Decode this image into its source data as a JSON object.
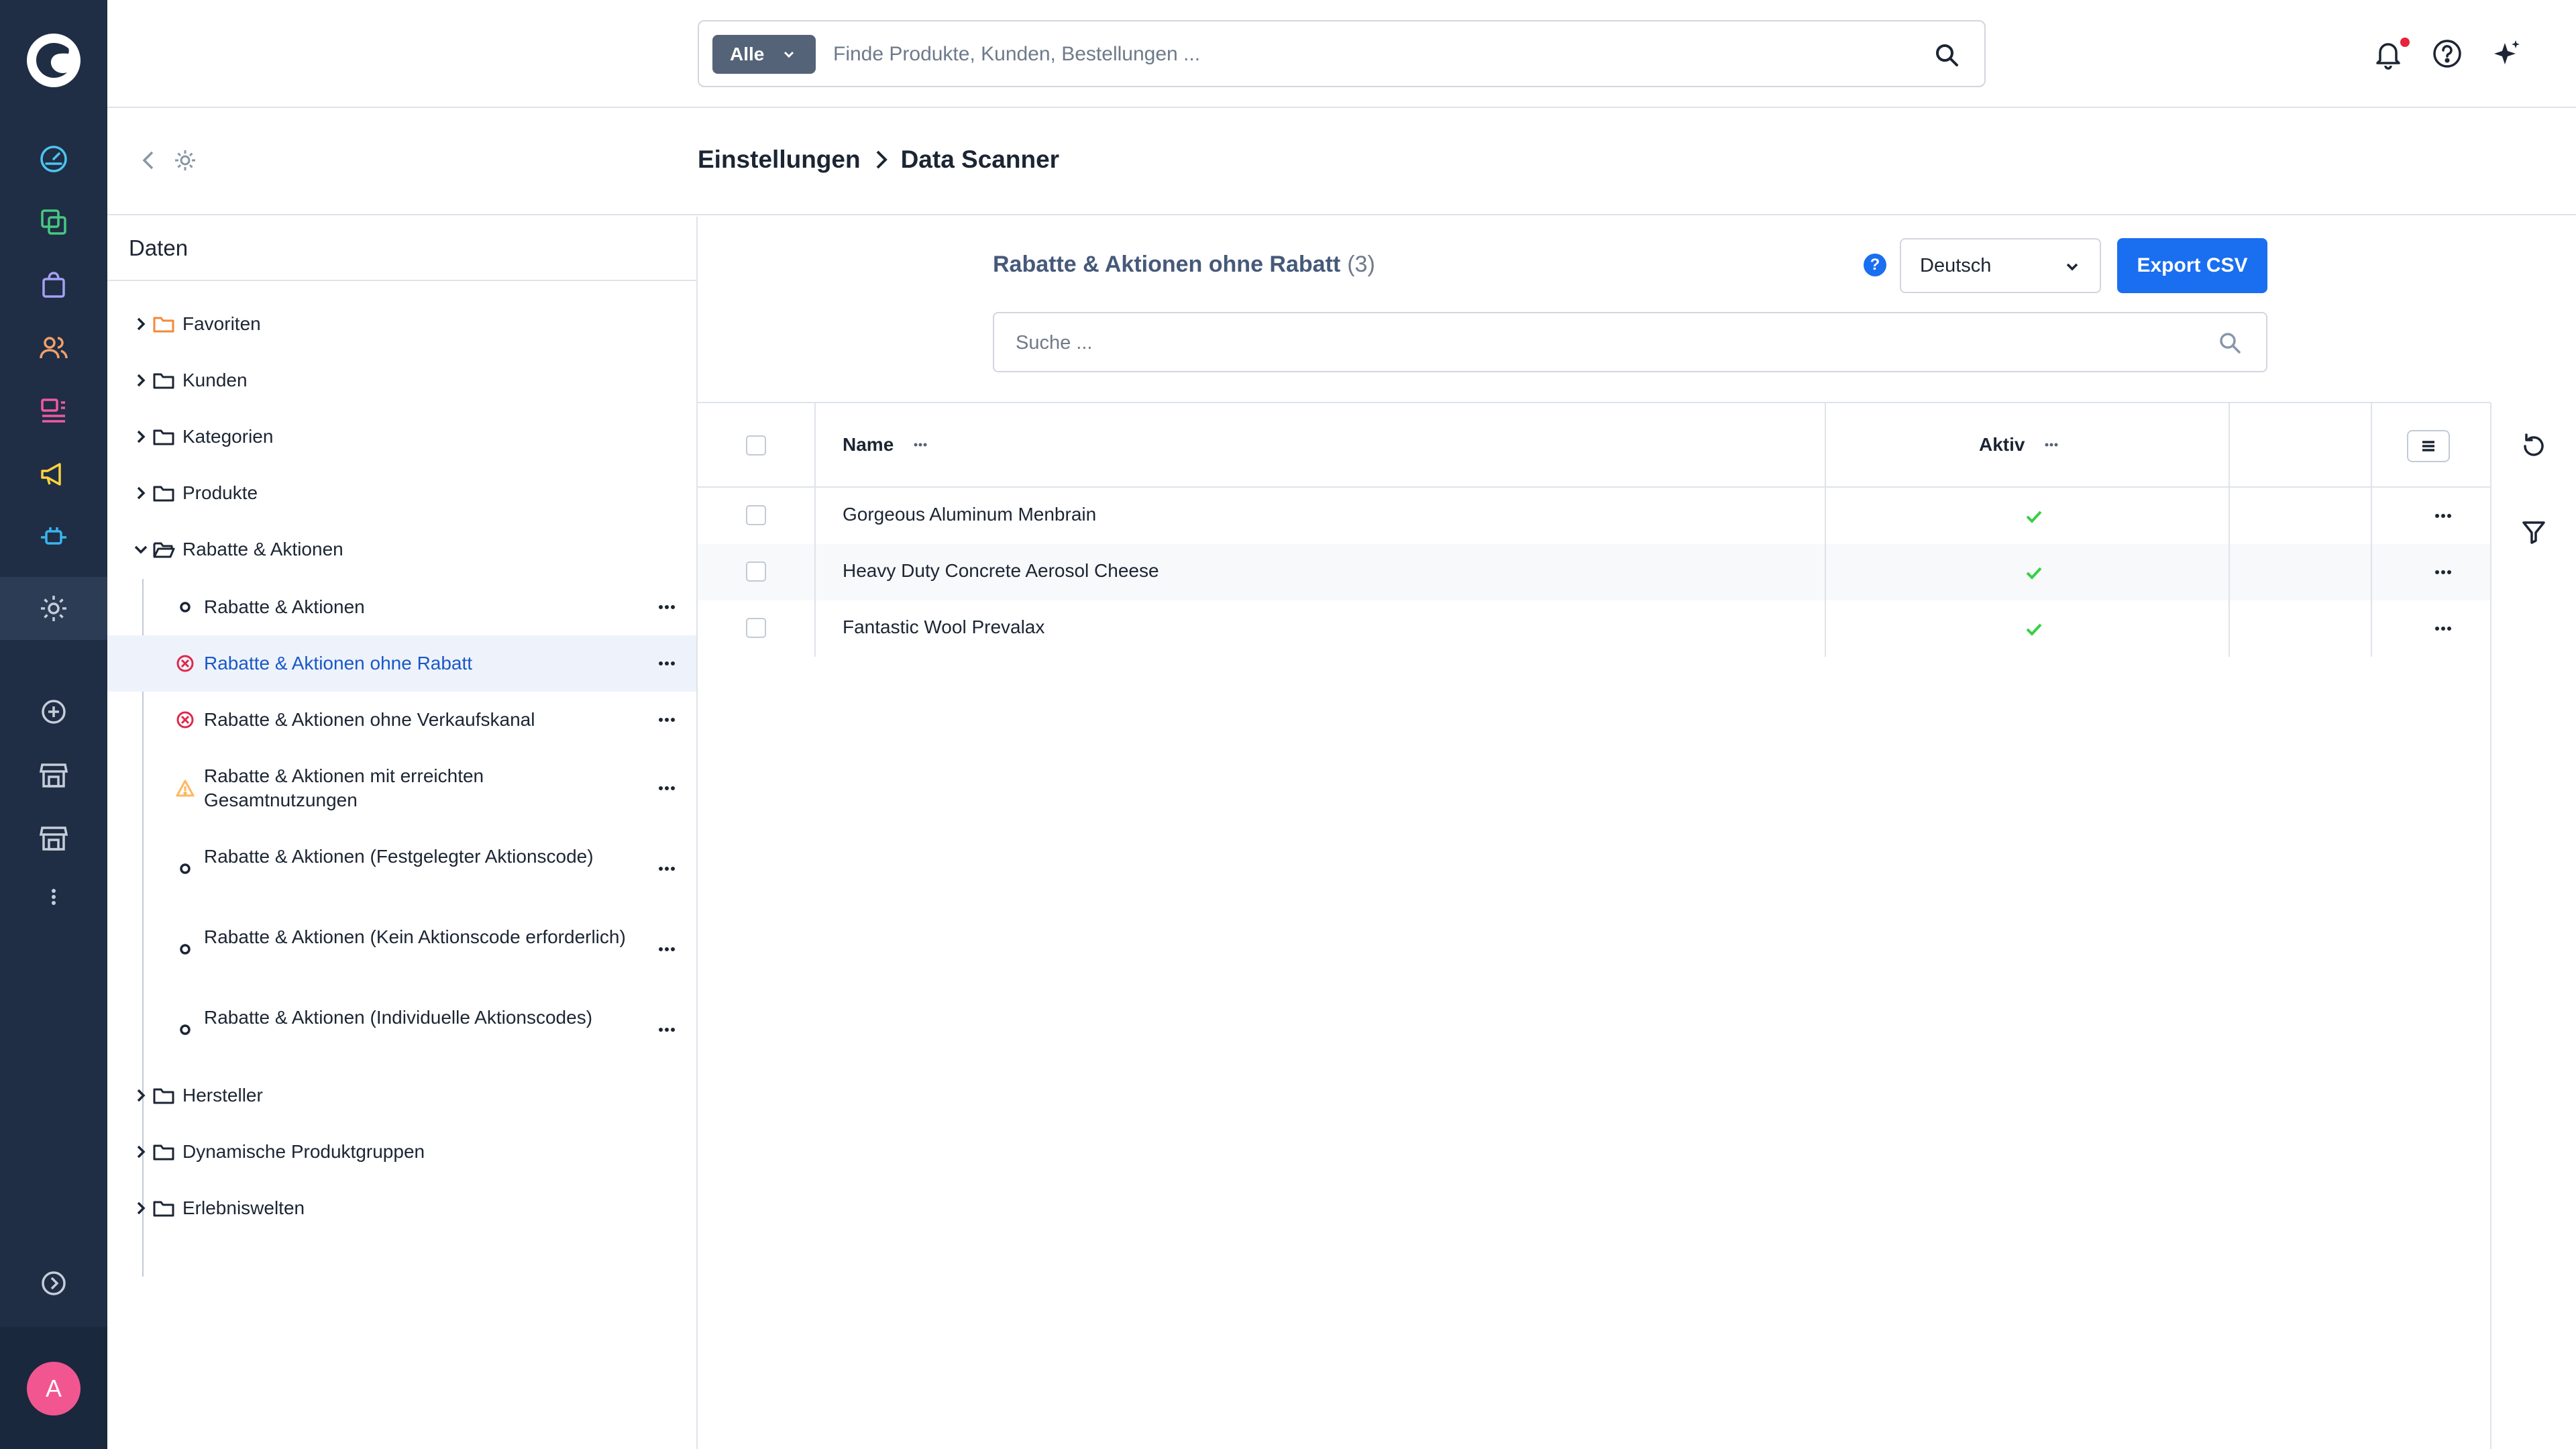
{
  "header": {
    "search_type": "Alle",
    "search_placeholder": "Finde Produkte, Kunden, Bestellungen ..."
  },
  "breadcrumb": {
    "parent": "Einstellungen",
    "current": "Data Scanner"
  },
  "user": {
    "avatar_initial": "A"
  },
  "tree": {
    "title": "Daten",
    "folders_top": [
      {
        "label": "Favoriten",
        "icon": "folder-icon",
        "color": "#f28a3a"
      },
      {
        "label": "Kunden",
        "icon": "folder-icon"
      },
      {
        "label": "Kategorien",
        "icon": "folder-icon"
      },
      {
        "label": "Produkte",
        "icon": "folder-icon"
      },
      {
        "label": "Rabatte & Aktionen",
        "icon": "folder-open-icon",
        "expanded": true
      }
    ],
    "children": [
      {
        "label": "Rabatte & Aktionen",
        "status": "neutral"
      },
      {
        "label": "Rabatte & Aktionen ohne Rabatt",
        "status": "error",
        "selected": true
      },
      {
        "label": "Rabatte & Aktionen ohne Verkaufskanal",
        "status": "error"
      },
      {
        "label": "Rabatte & Aktionen mit erreichten Gesamtnutzungen",
        "status": "warning"
      },
      {
        "label": "Rabatte & Aktionen (Festgelegter Aktionscode)",
        "status": "neutral"
      },
      {
        "label": "Rabatte & Aktionen (Kein Aktionscode erforderlich)",
        "status": "neutral"
      },
      {
        "label": "Rabatte & Aktionen (Individuelle Aktionscodes)",
        "status": "neutral"
      }
    ],
    "folders_bottom": [
      {
        "label": "Hersteller"
      },
      {
        "label": "Dynamische Produktgruppen"
      },
      {
        "label": "Erlebniswelten"
      }
    ]
  },
  "content": {
    "title": "Rabatte & Aktionen ohne Rabatt",
    "count": "(3)",
    "language": "Deutsch",
    "export_label": "Export CSV",
    "search_placeholder": "Suche ..."
  },
  "grid": {
    "columns": [
      "Name",
      "Aktiv"
    ],
    "rows": [
      {
        "name": "Gorgeous Aluminum Menbrain",
        "active": true
      },
      {
        "name": "Heavy Duty Concrete Aerosol Cheese",
        "active": true
      },
      {
        "name": "Fantastic Wool Prevalax",
        "active": true
      }
    ]
  },
  "colors": {
    "rail_bg": "#1f2e45",
    "accent_blue": "#1a6ef0",
    "success_green": "#37d046",
    "error_red": "#de294c",
    "warning_orange": "#ffb75d",
    "avatar_pink": "#f25691"
  }
}
